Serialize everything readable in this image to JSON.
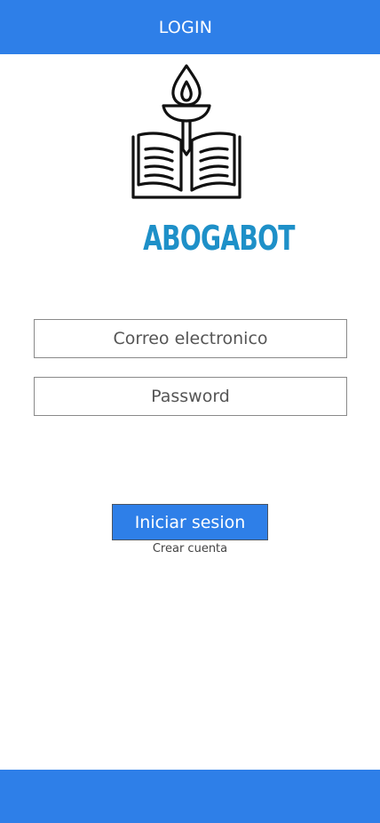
{
  "header": {
    "title": "LOGIN"
  },
  "logo": {
    "text": "ABOGABOT",
    "icon": "book-torch-icon",
    "text_color": "#1e90c8",
    "icon_color": "#111111"
  },
  "form": {
    "email_placeholder": "Correo electronico",
    "email_value": "",
    "password_placeholder": "Password",
    "password_value": "",
    "submit_label": "Iniciar sesion",
    "create_account_label": "Crear cuenta"
  },
  "colors": {
    "accent": "#2e7fe8",
    "background": "#ffffff"
  }
}
